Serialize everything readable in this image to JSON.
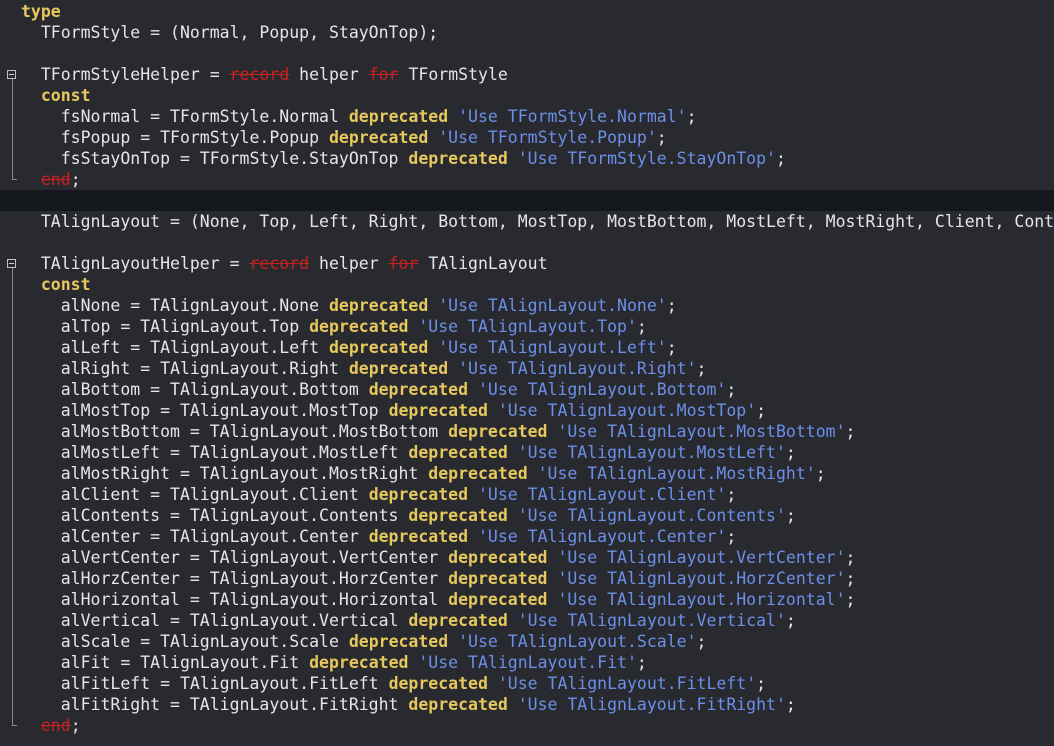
{
  "editor": {
    "lines": [
      {
        "tokens": [
          {
            "t": "type",
            "c": "kw"
          }
        ]
      },
      {
        "tokens": [
          {
            "t": "  TFormStyle = (Normal, Popup, StayOnTop);",
            "c": "id"
          }
        ]
      },
      {
        "tokens": []
      },
      {
        "fold": "start",
        "tokens": [
          {
            "t": "  TFormStyleHelper = ",
            "c": "id"
          },
          {
            "t": "record",
            "c": "kw2"
          },
          {
            "t": " helper ",
            "c": "id"
          },
          {
            "t": "for",
            "c": "kw2"
          },
          {
            "t": " TFormStyle",
            "c": "id"
          }
        ]
      },
      {
        "tokens": [
          {
            "t": "  const",
            "c": "kw"
          }
        ]
      },
      {
        "tokens": [
          {
            "t": "    fsNormal = TFormStyle.Normal ",
            "c": "id"
          },
          {
            "t": "deprecated",
            "c": "kw"
          },
          {
            "t": " ",
            "c": "id"
          },
          {
            "t": "'Use TFormStyle.Normal'",
            "c": "str"
          },
          {
            "t": ";",
            "c": "id"
          }
        ]
      },
      {
        "tokens": [
          {
            "t": "    fsPopup = TFormStyle.Popup ",
            "c": "id"
          },
          {
            "t": "deprecated",
            "c": "kw"
          },
          {
            "t": " ",
            "c": "id"
          },
          {
            "t": "'Use TFormStyle.Popup'",
            "c": "str"
          },
          {
            "t": ";",
            "c": "id"
          }
        ]
      },
      {
        "tokens": [
          {
            "t": "    fsStayOnTop = TFormStyle.StayOnTop ",
            "c": "id"
          },
          {
            "t": "deprecated",
            "c": "kw"
          },
          {
            "t": " ",
            "c": "id"
          },
          {
            "t": "'Use TFormStyle.StayOnTop'",
            "c": "str"
          },
          {
            "t": ";",
            "c": "id"
          }
        ]
      },
      {
        "fold": "end",
        "tokens": [
          {
            "t": "  ",
            "c": "id"
          },
          {
            "t": "end",
            "c": "kw2"
          },
          {
            "t": ";",
            "c": "id"
          }
        ]
      },
      {
        "current": true,
        "tokens": []
      },
      {
        "tokens": [
          {
            "t": "  TAlignLayout = (None, Top, Left, Right, Bottom, MostTop, MostBottom, MostLeft, MostRight, Client, Contents",
            "c": "id"
          }
        ]
      },
      {
        "tokens": []
      },
      {
        "fold": "start",
        "tokens": [
          {
            "t": "  TAlignLayoutHelper = ",
            "c": "id"
          },
          {
            "t": "record",
            "c": "kw2"
          },
          {
            "t": " helper ",
            "c": "id"
          },
          {
            "t": "for",
            "c": "kw2"
          },
          {
            "t": " TAlignLayout",
            "c": "id"
          }
        ]
      },
      {
        "tokens": [
          {
            "t": "  const",
            "c": "kw"
          }
        ]
      },
      {
        "tokens": [
          {
            "t": "    alNone = TAlignLayout.None ",
            "c": "id"
          },
          {
            "t": "deprecated",
            "c": "kw"
          },
          {
            "t": " ",
            "c": "id"
          },
          {
            "t": "'Use TAlignLayout.None'",
            "c": "str"
          },
          {
            "t": ";",
            "c": "id"
          }
        ]
      },
      {
        "tokens": [
          {
            "t": "    alTop = TAlignLayout.Top ",
            "c": "id"
          },
          {
            "t": "deprecated",
            "c": "kw"
          },
          {
            "t": " ",
            "c": "id"
          },
          {
            "t": "'Use TAlignLayout.Top'",
            "c": "str"
          },
          {
            "t": ";",
            "c": "id"
          }
        ]
      },
      {
        "tokens": [
          {
            "t": "    alLeft = TAlignLayout.Left ",
            "c": "id"
          },
          {
            "t": "deprecated",
            "c": "kw"
          },
          {
            "t": " ",
            "c": "id"
          },
          {
            "t": "'Use TAlignLayout.Left'",
            "c": "str"
          },
          {
            "t": ";",
            "c": "id"
          }
        ]
      },
      {
        "tokens": [
          {
            "t": "    alRight = TAlignLayout.Right ",
            "c": "id"
          },
          {
            "t": "deprecated",
            "c": "kw"
          },
          {
            "t": " ",
            "c": "id"
          },
          {
            "t": "'Use TAlignLayout.Right'",
            "c": "str"
          },
          {
            "t": ";",
            "c": "id"
          }
        ]
      },
      {
        "tokens": [
          {
            "t": "    alBottom = TAlignLayout.Bottom ",
            "c": "id"
          },
          {
            "t": "deprecated",
            "c": "kw"
          },
          {
            "t": " ",
            "c": "id"
          },
          {
            "t": "'Use TAlignLayout.Bottom'",
            "c": "str"
          },
          {
            "t": ";",
            "c": "id"
          }
        ]
      },
      {
        "tokens": [
          {
            "t": "    alMostTop = TAlignLayout.MostTop ",
            "c": "id"
          },
          {
            "t": "deprecated",
            "c": "kw"
          },
          {
            "t": " ",
            "c": "id"
          },
          {
            "t": "'Use TAlignLayout.MostTop'",
            "c": "str"
          },
          {
            "t": ";",
            "c": "id"
          }
        ]
      },
      {
        "tokens": [
          {
            "t": "    alMostBottom = TAlignLayout.MostBottom ",
            "c": "id"
          },
          {
            "t": "deprecated",
            "c": "kw"
          },
          {
            "t": " ",
            "c": "id"
          },
          {
            "t": "'Use TAlignLayout.MostBottom'",
            "c": "str"
          },
          {
            "t": ";",
            "c": "id"
          }
        ]
      },
      {
        "tokens": [
          {
            "t": "    alMostLeft = TAlignLayout.MostLeft ",
            "c": "id"
          },
          {
            "t": "deprecated",
            "c": "kw"
          },
          {
            "t": " ",
            "c": "id"
          },
          {
            "t": "'Use TAlignLayout.MostLeft'",
            "c": "str"
          },
          {
            "t": ";",
            "c": "id"
          }
        ]
      },
      {
        "tokens": [
          {
            "t": "    alMostRight = TAlignLayout.MostRight ",
            "c": "id"
          },
          {
            "t": "deprecated",
            "c": "kw"
          },
          {
            "t": " ",
            "c": "id"
          },
          {
            "t": "'Use TAlignLayout.MostRight'",
            "c": "str"
          },
          {
            "t": ";",
            "c": "id"
          }
        ]
      },
      {
        "tokens": [
          {
            "t": "    alClient = TAlignLayout.Client ",
            "c": "id"
          },
          {
            "t": "deprecated",
            "c": "kw"
          },
          {
            "t": " ",
            "c": "id"
          },
          {
            "t": "'Use TAlignLayout.Client'",
            "c": "str"
          },
          {
            "t": ";",
            "c": "id"
          }
        ]
      },
      {
        "tokens": [
          {
            "t": "    alContents = TAlignLayout.Contents ",
            "c": "id"
          },
          {
            "t": "deprecated",
            "c": "kw"
          },
          {
            "t": " ",
            "c": "id"
          },
          {
            "t": "'Use TAlignLayout.Contents'",
            "c": "str"
          },
          {
            "t": ";",
            "c": "id"
          }
        ]
      },
      {
        "tokens": [
          {
            "t": "    alCenter = TAlignLayout.Center ",
            "c": "id"
          },
          {
            "t": "deprecated",
            "c": "kw"
          },
          {
            "t": " ",
            "c": "id"
          },
          {
            "t": "'Use TAlignLayout.Center'",
            "c": "str"
          },
          {
            "t": ";",
            "c": "id"
          }
        ]
      },
      {
        "tokens": [
          {
            "t": "    alVertCenter = TAlignLayout.VertCenter ",
            "c": "id"
          },
          {
            "t": "deprecated",
            "c": "kw"
          },
          {
            "t": " ",
            "c": "id"
          },
          {
            "t": "'Use TAlignLayout.VertCenter'",
            "c": "str"
          },
          {
            "t": ";",
            "c": "id"
          }
        ]
      },
      {
        "tokens": [
          {
            "t": "    alHorzCenter = TAlignLayout.HorzCenter ",
            "c": "id"
          },
          {
            "t": "deprecated",
            "c": "kw"
          },
          {
            "t": " ",
            "c": "id"
          },
          {
            "t": "'Use TAlignLayout.HorzCenter'",
            "c": "str"
          },
          {
            "t": ";",
            "c": "id"
          }
        ]
      },
      {
        "tokens": [
          {
            "t": "    alHorizontal = TAlignLayout.Horizontal ",
            "c": "id"
          },
          {
            "t": "deprecated",
            "c": "kw"
          },
          {
            "t": " ",
            "c": "id"
          },
          {
            "t": "'Use TAlignLayout.Horizontal'",
            "c": "str"
          },
          {
            "t": ";",
            "c": "id"
          }
        ]
      },
      {
        "tokens": [
          {
            "t": "    alVertical = TAlignLayout.Vertical ",
            "c": "id"
          },
          {
            "t": "deprecated",
            "c": "kw"
          },
          {
            "t": " ",
            "c": "id"
          },
          {
            "t": "'Use TAlignLayout.Vertical'",
            "c": "str"
          },
          {
            "t": ";",
            "c": "id"
          }
        ]
      },
      {
        "tokens": [
          {
            "t": "    alScale = TAlignLayout.Scale ",
            "c": "id"
          },
          {
            "t": "deprecated",
            "c": "kw"
          },
          {
            "t": " ",
            "c": "id"
          },
          {
            "t": "'Use TAlignLayout.Scale'",
            "c": "str"
          },
          {
            "t": ";",
            "c": "id"
          }
        ]
      },
      {
        "tokens": [
          {
            "t": "    alFit = TAlignLayout.Fit ",
            "c": "id"
          },
          {
            "t": "deprecated",
            "c": "kw"
          },
          {
            "t": " ",
            "c": "id"
          },
          {
            "t": "'Use TAlignLayout.Fit'",
            "c": "str"
          },
          {
            "t": ";",
            "c": "id"
          }
        ]
      },
      {
        "tokens": [
          {
            "t": "    alFitLeft = TAlignLayout.FitLeft ",
            "c": "id"
          },
          {
            "t": "deprecated",
            "c": "kw"
          },
          {
            "t": " ",
            "c": "id"
          },
          {
            "t": "'Use TAlignLayout.FitLeft'",
            "c": "str"
          },
          {
            "t": ";",
            "c": "id"
          }
        ]
      },
      {
        "tokens": [
          {
            "t": "    alFitRight = TAlignLayout.FitRight ",
            "c": "id"
          },
          {
            "t": "deprecated",
            "c": "kw"
          },
          {
            "t": " ",
            "c": "id"
          },
          {
            "t": "'Use TAlignLayout.FitRight'",
            "c": "str"
          },
          {
            "t": ";",
            "c": "id"
          }
        ]
      },
      {
        "fold": "end",
        "tokens": [
          {
            "t": "  ",
            "c": "id"
          },
          {
            "t": "end",
            "c": "kw2"
          },
          {
            "t": ";",
            "c": "id"
          }
        ]
      }
    ]
  },
  "colors": {
    "background": "#282a30",
    "current_line": "#14171c",
    "keyword": "#e6c85c",
    "string": "#6c8fe8",
    "deprecated_keyword": "#c5221f",
    "identifier": "#e6e6e6"
  }
}
